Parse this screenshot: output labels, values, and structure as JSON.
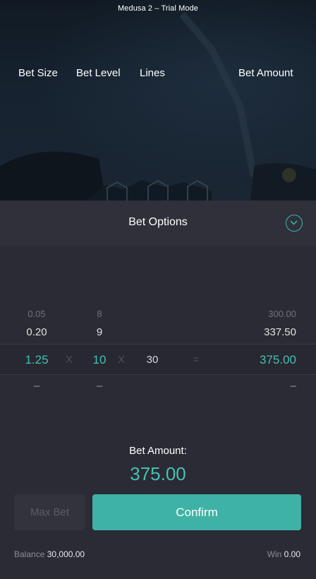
{
  "window": {
    "title": "Medusa 2 – Trial Mode"
  },
  "panel": {
    "title": "Bet Options"
  },
  "columns": {
    "bet_size": "Bet Size",
    "bet_level": "Bet Level",
    "lines": "Lines",
    "bet_amount": "Bet Amount"
  },
  "pickers": {
    "bet_size": {
      "above2": "0.05",
      "above1": "0.20",
      "selected": "1.25",
      "below": "–"
    },
    "bet_level": {
      "above2": "8",
      "above1": "9",
      "selected": "10",
      "below": "–"
    },
    "lines": {
      "selected": "30"
    },
    "bet_amount": {
      "above2": "300.00",
      "above1": "337.50",
      "selected": "375.00",
      "below": "–"
    },
    "operators": {
      "times1": "X",
      "times2": "X",
      "equals": "="
    }
  },
  "summary": {
    "label": "Bet Amount:",
    "value": "375.00"
  },
  "buttons": {
    "max_bet": "Max Bet",
    "confirm": "Confirm"
  },
  "footer": {
    "balance_label": "Balance",
    "balance_value": "30,000.00",
    "win_label": "Win",
    "win_value": "0.00"
  },
  "colors": {
    "accent": "#47c0b3",
    "confirm_bg": "#3fb2a6",
    "panel_bg": "#2d2e38"
  },
  "icons": {
    "collapse": "chevron-down-icon"
  }
}
